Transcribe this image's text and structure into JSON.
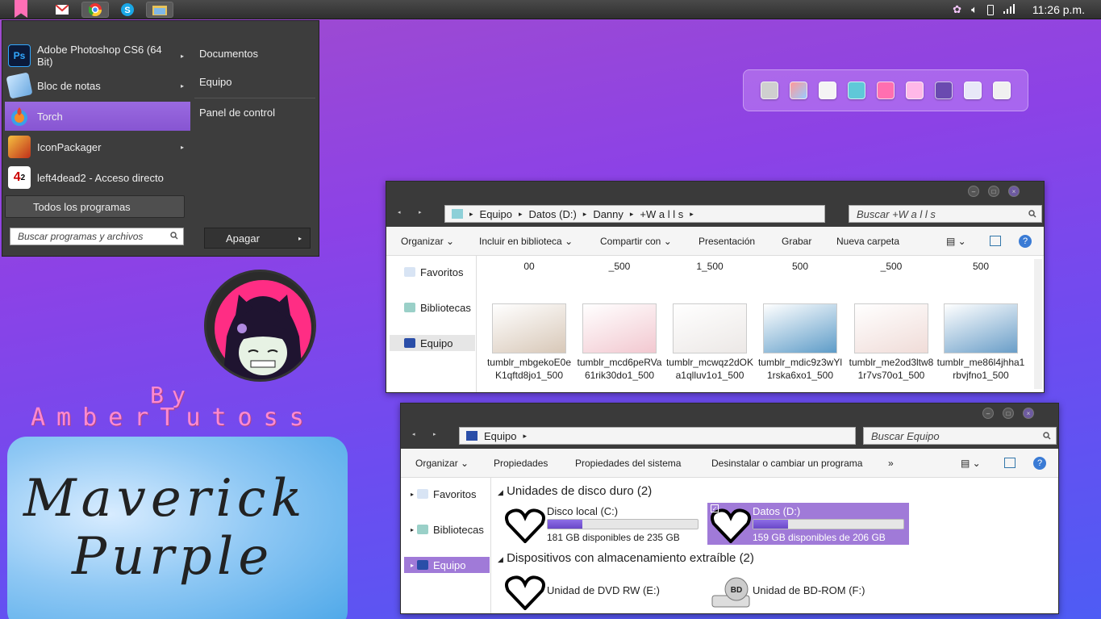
{
  "taskbar": {
    "clock": "11:26 p.m."
  },
  "start_menu": {
    "programs": [
      {
        "label": "Adobe Photoshop CS6 (64 Bit)",
        "icon": "photoshop-icon",
        "has_submenu": true
      },
      {
        "label": "Bloc de notas",
        "icon": "notepad-icon",
        "has_submenu": true
      },
      {
        "label": "Torch",
        "icon": "torch-icon",
        "has_submenu": false
      },
      {
        "label": "IconPackager",
        "icon": "iconpackager-icon",
        "has_submenu": true
      },
      {
        "label": "left4dead2 - Acceso directo",
        "icon": "left4dead2-icon",
        "has_submenu": false
      }
    ],
    "all_programs": "Todos los programas",
    "search_placeholder": "Buscar programas y archivos",
    "places": [
      "Documentos",
      "Equipo",
      "Panel de control"
    ],
    "shutdown": "Apagar"
  },
  "desktop": {
    "by": "By",
    "author": "AmberTutoss",
    "wallpaper_line1": "Maverick",
    "wallpaper_line2": "Purple"
  },
  "window1": {
    "breadcrumb": [
      "Equipo",
      "Datos (D:)",
      "Danny",
      "+W a l l s"
    ],
    "search_placeholder": "Buscar +W a l l s",
    "toolbar": [
      "Organizar",
      "Incluir en biblioteca",
      "Compartir con",
      "Presentación",
      "Grabar",
      "Nueva carpeta"
    ],
    "nav": [
      "Favoritos",
      "Bibliotecas",
      "Equipo"
    ],
    "cut_labels": [
      "00",
      "_500",
      "1_500",
      "500",
      "_500",
      "500"
    ],
    "files": [
      {
        "name": "tumblr_mbgekoE0eK1qftd8jo1_500",
        "color": "#d8c8b8"
      },
      {
        "name": "tumblr_mcd6peRVa61rik30do1_500",
        "color": "#f2c8d0"
      },
      {
        "name": "tumblr_mcwqz2dOKa1qlluv1o1_500",
        "color": "#ece8e6"
      },
      {
        "name": "tumblr_mdic9z3wYl1rska6xo1_500",
        "color": "#5e9cc8"
      },
      {
        "name": "tumblr_me2od3ltw81r7vs70o1_500",
        "color": "#f0dcd8"
      },
      {
        "name": "tumblr_me86l4jhha1rbvjfno1_500",
        "color": "#6a9ec8"
      }
    ]
  },
  "window2": {
    "breadcrumb": [
      "Equipo"
    ],
    "search_placeholder": "Buscar Equipo",
    "toolbar": [
      "Organizar",
      "Propiedades",
      "Propiedades del sistema",
      "Desinstalar o cambiar un programa",
      "»"
    ],
    "nav": [
      "Favoritos",
      "Bibliotecas",
      "Equipo"
    ],
    "section_hdd": "Unidades de disco duro (2)",
    "section_removable": "Dispositivos con almacenamiento extraíble (2)",
    "drives": [
      {
        "name": "Disco local (C:)",
        "free": "181 GB disponibles de 235 GB",
        "used_fraction": 0.23
      },
      {
        "name": "Datos (D:)",
        "free": "159 GB disponibles de 206 GB",
        "used_fraction": 0.23
      }
    ],
    "removable": [
      "Unidad de DVD RW (E:)",
      "Unidad de BD-ROM (F:)"
    ]
  },
  "colors": {
    "accent": "#8d60d8",
    "pink": "#ff8ad0"
  }
}
